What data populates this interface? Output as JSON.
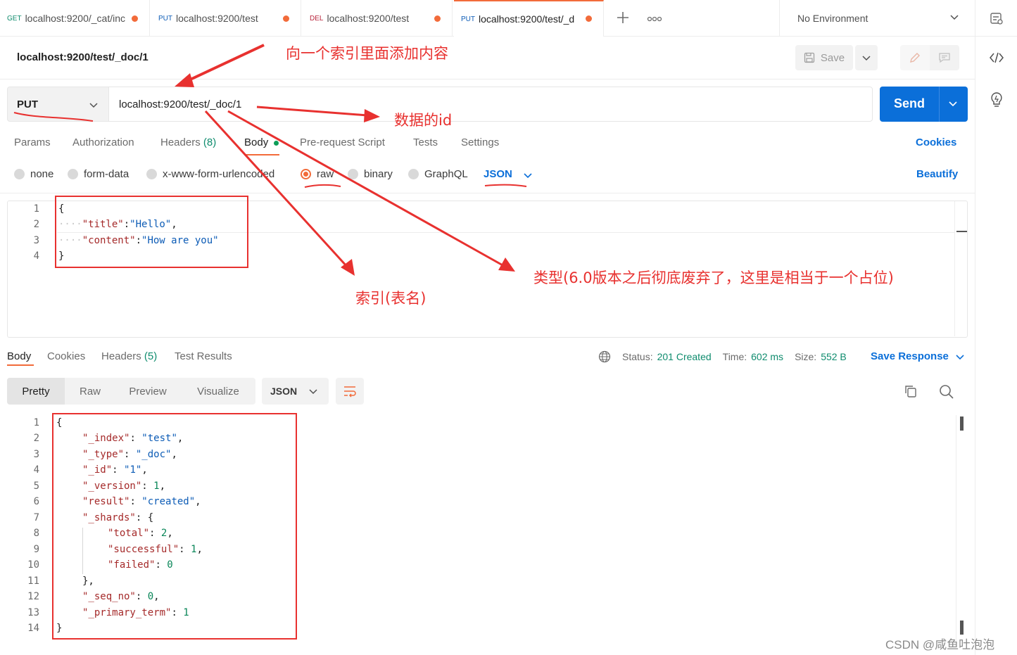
{
  "tabs": [
    {
      "method": "GET",
      "label": "localhost:9200/_cat/inc"
    },
    {
      "method": "PUT",
      "label": "localhost:9200/test"
    },
    {
      "method": "DEL",
      "label": "localhost:9200/test"
    },
    {
      "method": "PUT",
      "label": "localhost:9200/test/_d"
    }
  ],
  "environment": {
    "selected": "No Environment"
  },
  "request": {
    "title": "localhost:9200/test/_doc/1",
    "save_label": "Save",
    "method": "PUT",
    "url": "localhost:9200/test/_doc/1",
    "send_label": "Send"
  },
  "request_tabs": {
    "params": "Params",
    "authorization": "Authorization",
    "headers": "Headers",
    "headers_count": "(8)",
    "body": "Body",
    "pre_request": "Pre-request Script",
    "tests": "Tests",
    "settings": "Settings",
    "cookies": "Cookies"
  },
  "body_types": {
    "none": "none",
    "form_data": "form-data",
    "urlencoded": "x-www-form-urlencoded",
    "raw": "raw",
    "binary": "binary",
    "graphql": "GraphQL",
    "format": "JSON",
    "beautify": "Beautify"
  },
  "request_body_lines": [
    "1",
    "2",
    "3",
    "4"
  ],
  "request_body": {
    "open": "{",
    "l2_key": "\"title\"",
    "l2_val": "\"Hello\"",
    "l3_key": "\"content\"",
    "l3_val": "\"How are you\"",
    "close": "}"
  },
  "response_tabs": {
    "body": "Body",
    "cookies": "Cookies",
    "headers": "Headers",
    "headers_count": "(5)",
    "test_results": "Test Results"
  },
  "response_status": {
    "status_label": "Status:",
    "status_value": "201 Created",
    "time_label": "Time:",
    "time_value": "602 ms",
    "size_label": "Size:",
    "size_value": "552 B",
    "save_response": "Save Response"
  },
  "view_modes": {
    "pretty": "Pretty",
    "raw": "Raw",
    "preview": "Preview",
    "visualize": "Visualize",
    "format": "JSON"
  },
  "response_lines": [
    "1",
    "2",
    "3",
    "4",
    "5",
    "6",
    "7",
    "8",
    "9",
    "10",
    "11",
    "12",
    "13",
    "14"
  ],
  "response_body": {
    "open": "{",
    "index_key": "\"_index\"",
    "index_val": "\"test\"",
    "type_key": "\"_type\"",
    "type_val": "\"_doc\"",
    "id_key": "\"_id\"",
    "id_val": "\"1\"",
    "version_key": "\"_version\"",
    "version_val": "1",
    "result_key": "\"result\"",
    "result_val": "\"created\"",
    "shards_key": "\"_shards\"",
    "total_key": "\"total\"",
    "total_val": "2",
    "successful_key": "\"successful\"",
    "successful_val": "1",
    "failed_key": "\"failed\"",
    "failed_val": "0",
    "shards_close": "},",
    "seq_key": "\"_seq_no\"",
    "seq_val": "0",
    "term_key": "\"_primary_term\"",
    "term_val": "1",
    "close": "}"
  },
  "annotations": {
    "add_content": "向一个索引里面添加内容",
    "doc_id": "数据的id",
    "index_name": "索引(表名)",
    "type_note": "类型(6.0版本之后彻底废弃了，这里是相当于一个占位)"
  },
  "watermark": "CSDN @咸鱼吐泡泡",
  "colors": {
    "accent": "#f26b3a",
    "primary": "#0b6fd9",
    "annotation": "#e8312f",
    "success": "#0f8c6e"
  }
}
